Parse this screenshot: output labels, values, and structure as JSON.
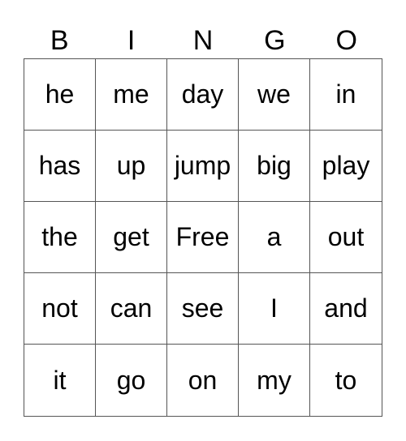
{
  "header": [
    "B",
    "I",
    "N",
    "G",
    "O"
  ],
  "cells": [
    [
      "he",
      "me",
      "day",
      "we",
      "in"
    ],
    [
      "has",
      "up",
      "jump",
      "big",
      "play"
    ],
    [
      "the",
      "get",
      "Free",
      "a",
      "out"
    ],
    [
      "not",
      "can",
      "see",
      "I",
      "and"
    ],
    [
      "it",
      "go",
      "on",
      "my",
      "to"
    ]
  ]
}
